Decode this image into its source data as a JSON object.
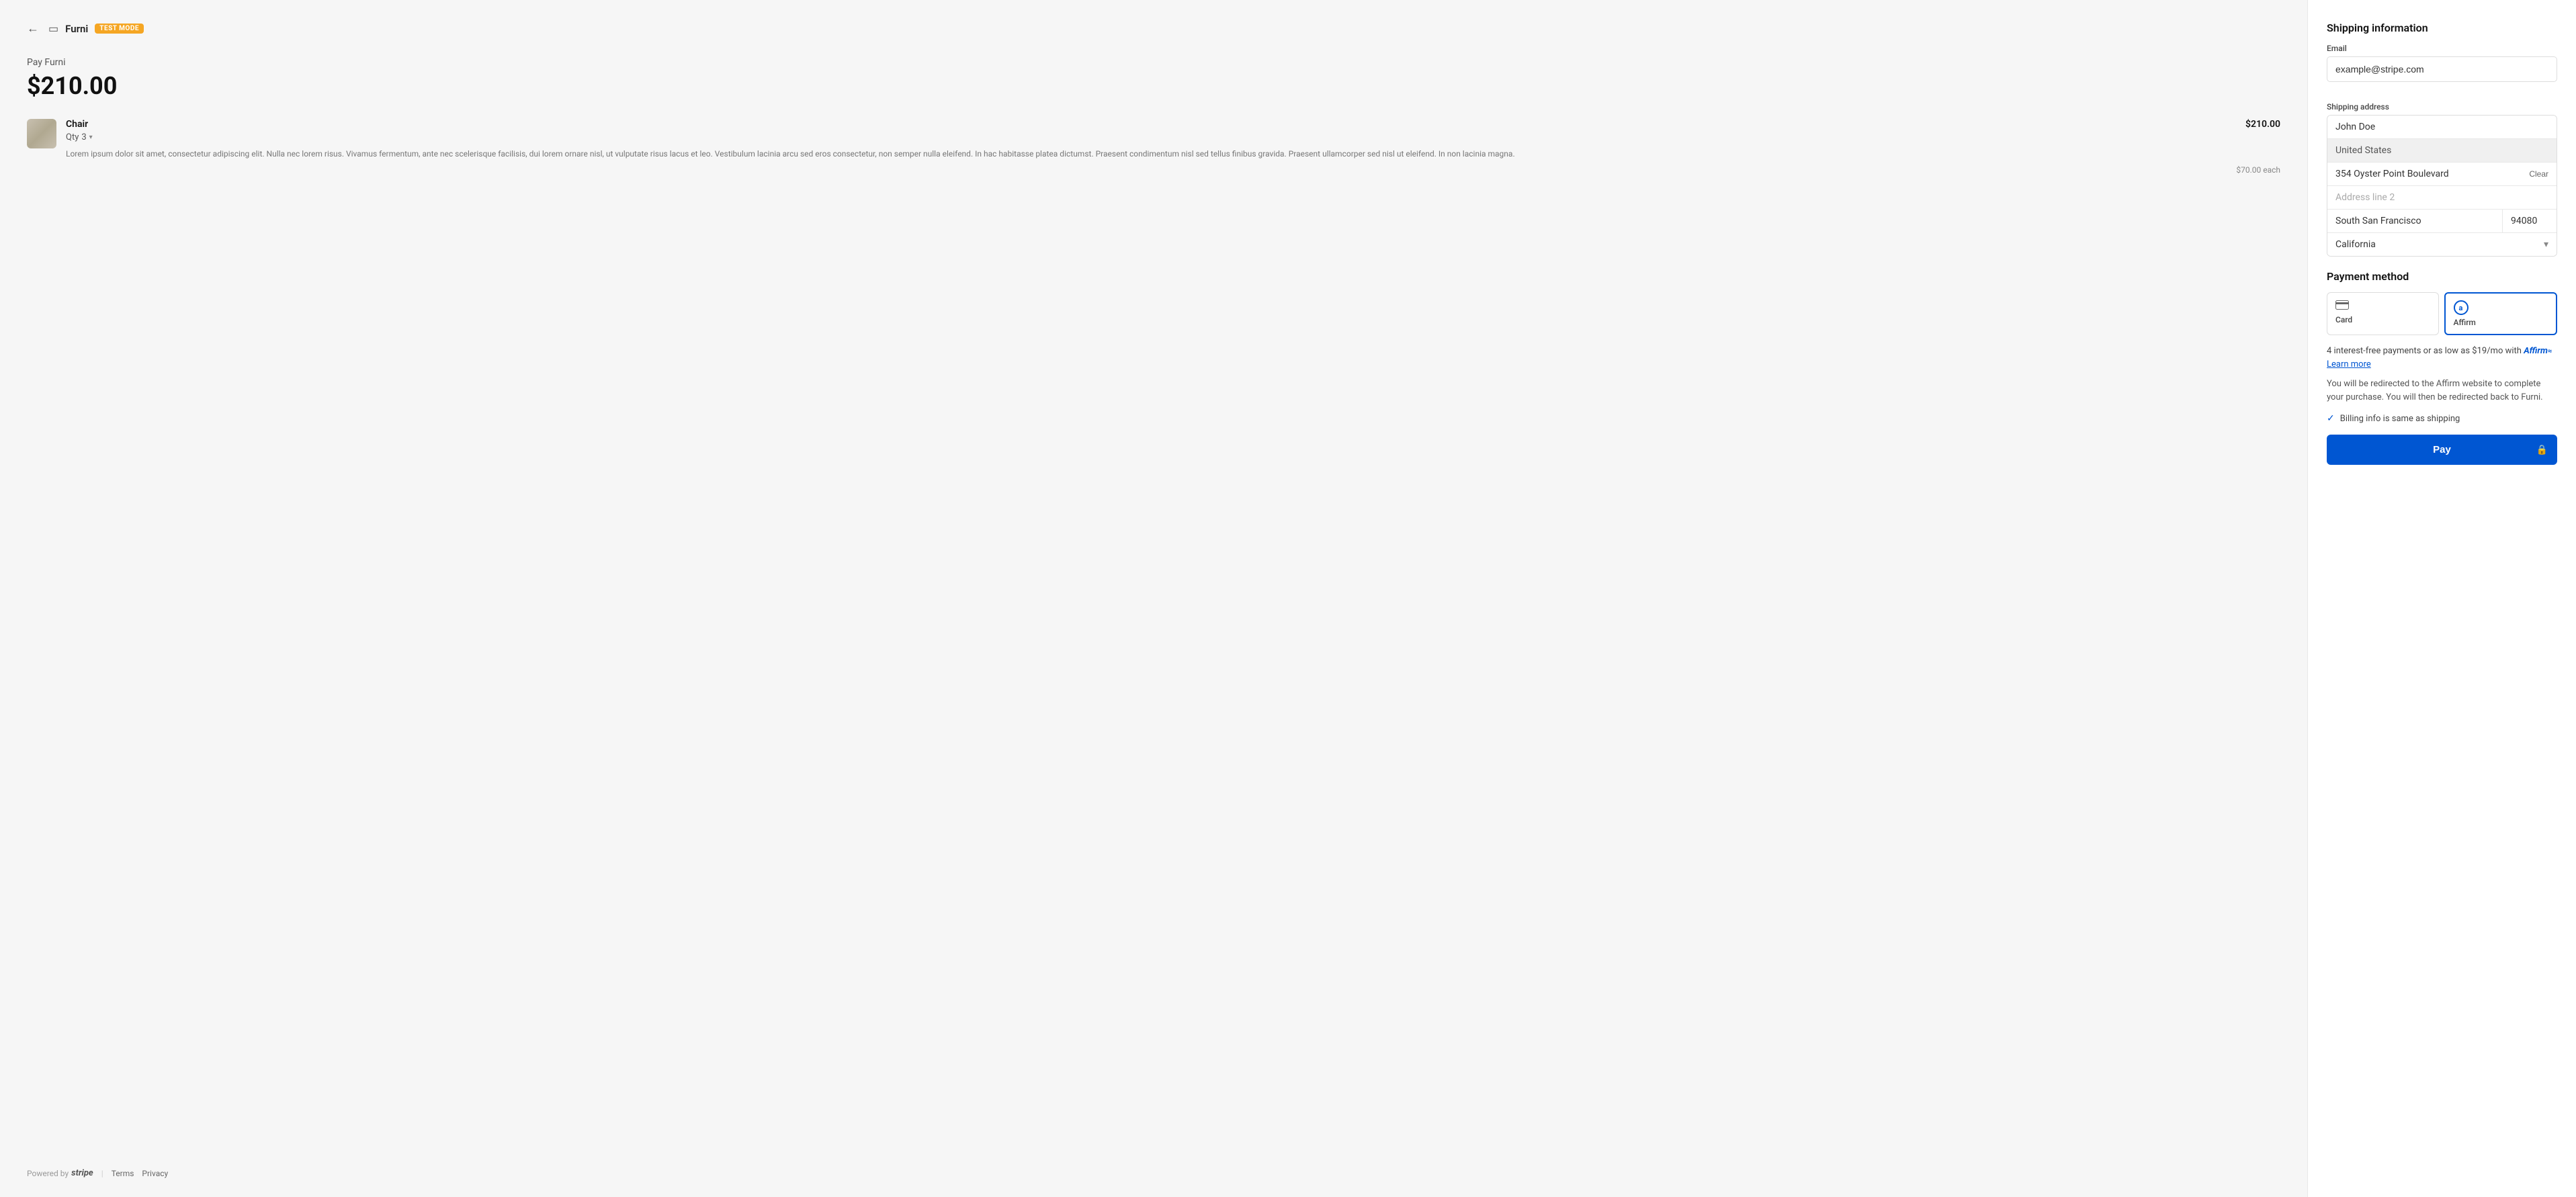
{
  "topbar": {
    "back_label": "←",
    "browser_icon": "▭",
    "brand": "Furni",
    "test_mode": "TEST MODE"
  },
  "order": {
    "pay_label": "Pay Furni",
    "amount": "$210.00",
    "item": {
      "name": "Chair",
      "price": "$210.00",
      "qty_label": "Qty",
      "qty": "3",
      "description": "Lorem ipsum dolor sit amet, consectetur adipiscing elit. Nulla nec lorem risus. Vivamus fermentum, ante nec scelerisque facilisis, dui lorem ornare nisl, ut vulputate risus lacus et leo. Vestibulum lacinia arcu sed eros consectetur, non semper nulla eleifend. In hac habitasse platea dictumst. Praesent condimentum nisl sed tellus finibus gravida. Praesent ullamcorper sed nisl ut eleifend. In non lacinia magna.",
      "unit_price": "$70.00 each"
    }
  },
  "footer": {
    "powered_by": "Powered by",
    "stripe": "stripe",
    "terms": "Terms",
    "privacy": "Privacy"
  },
  "right": {
    "shipping_title": "Shipping information",
    "email_label": "Email",
    "email_placeholder": "example@stripe.com",
    "email_value": "example@stripe.com",
    "shipping_label": "Shipping address",
    "name_value": "John Doe",
    "country_value": "United States",
    "street_value": "354 Oyster Point Boulevard",
    "clear_label": "Clear",
    "address_line2_placeholder": "Address line 2",
    "city_value": "South San Francisco",
    "zip_value": "94080",
    "state_value": "California",
    "payment_title": "Payment method",
    "payment_tabs": [
      {
        "id": "card",
        "icon": "▬",
        "label": "Card"
      },
      {
        "id": "affirm",
        "icon": "affirm",
        "label": "Affirm"
      }
    ],
    "affirm_promo": "4 interest-free payments or as low as $19/mo with",
    "affirm_brand": "Affirm",
    "learn_more": "Learn more",
    "affirm_notice": "You will be redirected to the Affirm website to complete your purchase. You will then be redirected back to Furni.",
    "billing_same": "Billing info is same as shipping",
    "pay_button": "Pay",
    "lock_icon": "🔒"
  }
}
